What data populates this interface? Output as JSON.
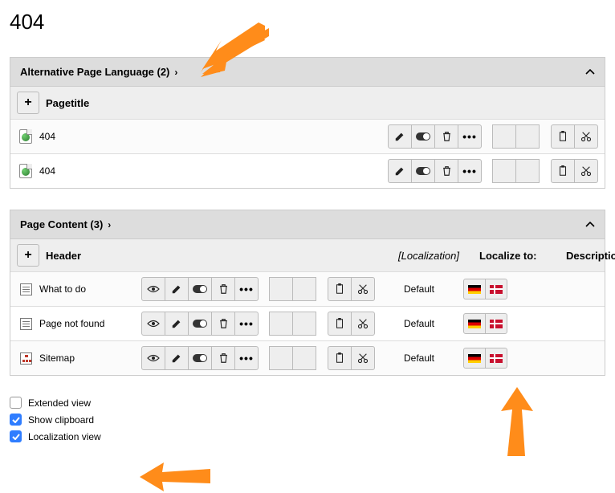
{
  "page_title": "404",
  "panel1": {
    "title": "Alternative Page Language (2)",
    "col_header": "Pagetitle",
    "rows": [
      {
        "title": "404"
      },
      {
        "title": "404"
      }
    ]
  },
  "panel2": {
    "title": "Page Content (3)",
    "cols": {
      "header": "Header",
      "localization": "[Localization]",
      "localize_to": "Localize to:",
      "description": "Description"
    },
    "rows": [
      {
        "icon": "content",
        "title": "What to do",
        "localization": "Default"
      },
      {
        "icon": "content",
        "title": "Page not found",
        "localization": "Default"
      },
      {
        "icon": "sitemap",
        "title": "Sitemap",
        "localization": "Default"
      }
    ]
  },
  "options": {
    "extended": {
      "label": "Extended view",
      "checked": false
    },
    "clipboard": {
      "label": "Show clipboard",
      "checked": true
    },
    "localization": {
      "label": "Localization view",
      "checked": true
    }
  }
}
